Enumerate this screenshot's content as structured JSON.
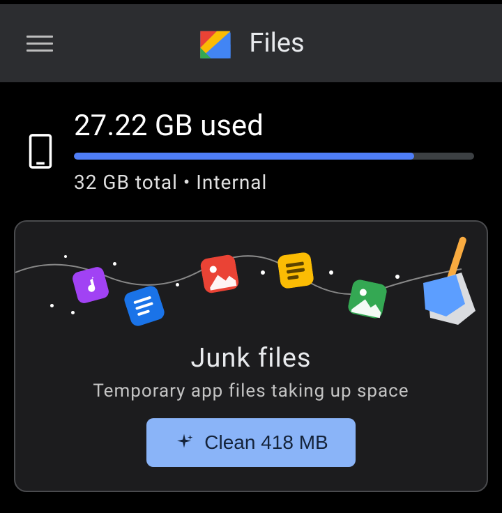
{
  "header": {
    "title": "Files"
  },
  "storage": {
    "used_label": "27.22 GB used",
    "total_label": "32 GB total • Internal",
    "progress_percent": 85
  },
  "card": {
    "title": "Junk files",
    "subtitle": "Temporary app files taking up space",
    "button_label": "Clean 418 MB"
  },
  "colors": {
    "accent": "#4f7ef7",
    "button": "#8ab4f8"
  }
}
